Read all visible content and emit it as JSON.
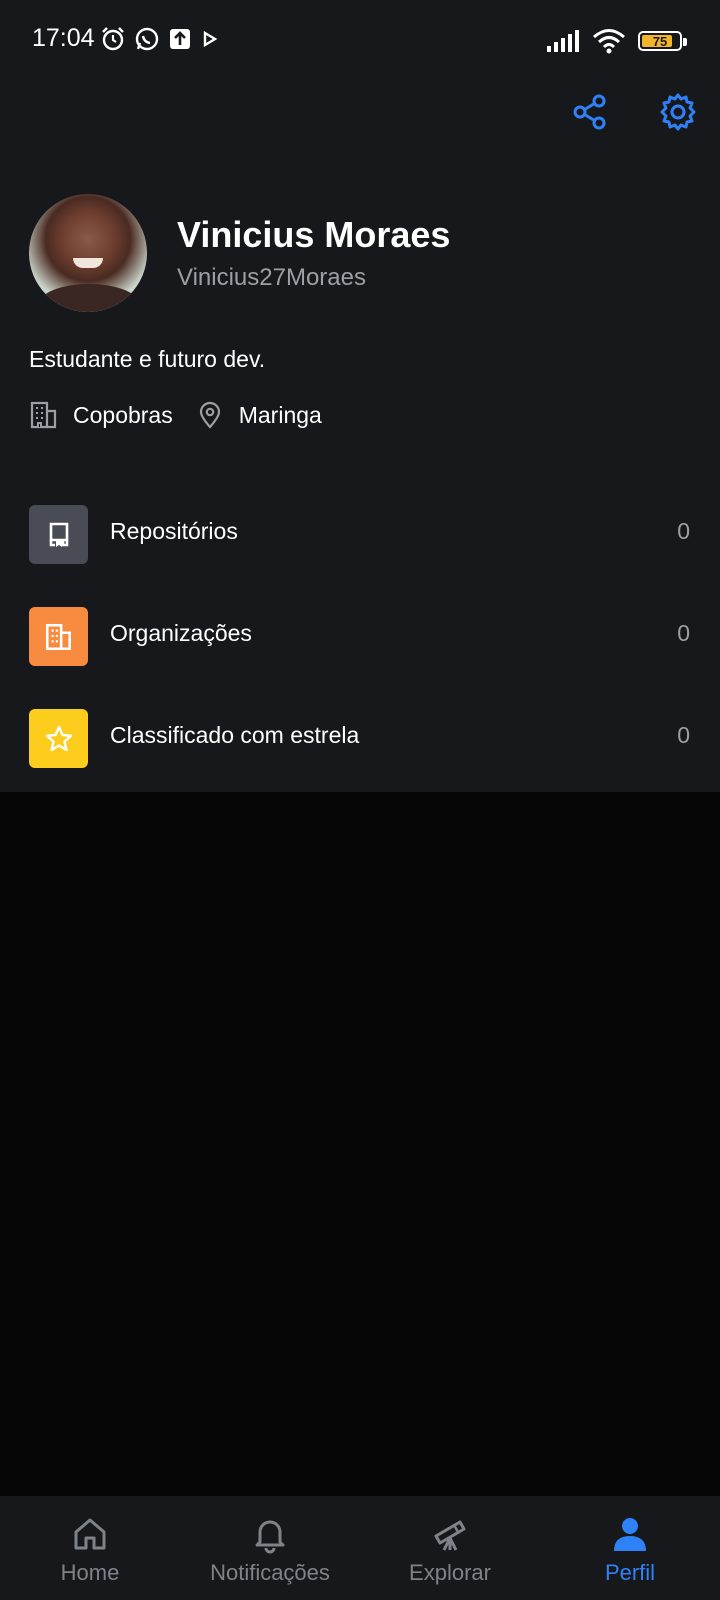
{
  "status_bar": {
    "time": "17:04",
    "battery_percent": "75",
    "icons": [
      "alarm-icon",
      "whatsapp-icon",
      "upload-icon",
      "play-icon",
      "signal-icon",
      "wifi-icon",
      "battery-icon"
    ]
  },
  "header": {
    "actions": [
      "share-icon",
      "gear-icon"
    ]
  },
  "profile": {
    "name": "Vinicius Moraes",
    "login": "Vinicius27Moraes",
    "bio": "Estudante e futuro dev.",
    "company": "Copobras",
    "location": "Maringa"
  },
  "list": [
    {
      "label": "Repositórios",
      "count": "0",
      "icon": "repo-icon",
      "color": "#4a4c55"
    },
    {
      "label": "Organizações",
      "count": "0",
      "icon": "organization-icon",
      "color": "#f78c40"
    },
    {
      "label": "Classificado com estrela",
      "count": "0",
      "icon": "star-icon",
      "color": "#fccd1c"
    }
  ],
  "tabs": [
    {
      "label": "Home",
      "icon": "home-icon",
      "active": false
    },
    {
      "label": "Notificações",
      "icon": "bell-icon",
      "active": false
    },
    {
      "label": "Explorar",
      "icon": "telescope-icon",
      "active": false
    },
    {
      "label": "Perfil",
      "icon": "person-icon",
      "active": true
    }
  ],
  "colors": {
    "accent": "#2f81f7",
    "panel_background": "#17181c",
    "page_background": "#050505",
    "muted_text": "#9aa0a6"
  }
}
